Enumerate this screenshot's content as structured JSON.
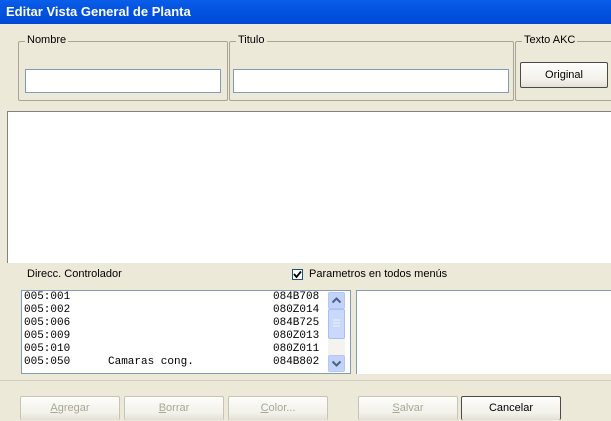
{
  "window": {
    "title": "Editar Vista General de Planta"
  },
  "groups": {
    "nombre_label": "Nombre",
    "titulo_label": "Titulo",
    "texto_akc_label": "Texto AKC"
  },
  "fields": {
    "nombre_value": "",
    "titulo_value": ""
  },
  "buttons": {
    "original": "Original",
    "agregar": "Agregar",
    "borrar": "Borrar",
    "color": "Color...",
    "salvar": "Salvar",
    "cancelar": "Cancelar"
  },
  "list_section": {
    "direcc_label": "Direcc. Controlador",
    "checkbox_label": "Parametros en todos menús",
    "checkbox_checked": true
  },
  "controller_list": [
    {
      "addr": "005:001",
      "desc": "",
      "code": "084B708"
    },
    {
      "addr": "005:002",
      "desc": "",
      "code": "080Z014"
    },
    {
      "addr": "005:006",
      "desc": "",
      "code": "084B725"
    },
    {
      "addr": "005:009",
      "desc": "",
      "code": "080Z013"
    },
    {
      "addr": "005:010",
      "desc": "",
      "code": "080Z011"
    },
    {
      "addr": "005:050",
      "desc": "Camaras cong.",
      "code": "084B802"
    }
  ]
}
